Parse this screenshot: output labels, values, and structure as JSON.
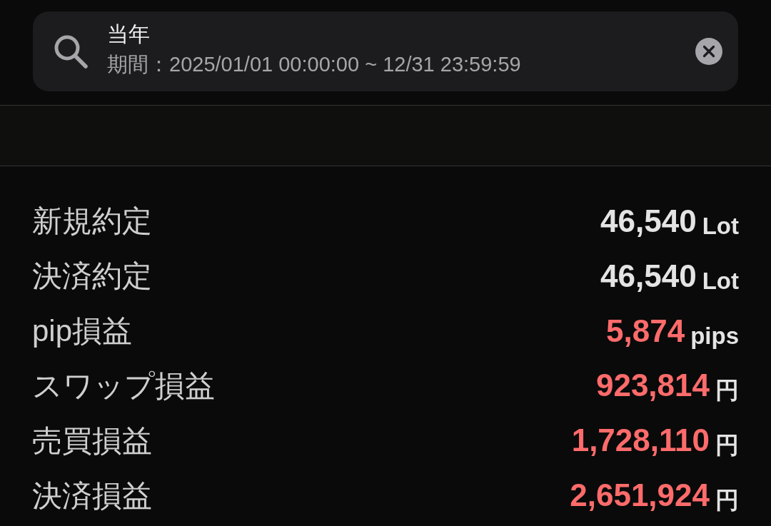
{
  "search": {
    "title": "当年",
    "period": "期間：2025/01/01 00:00:00 ~ 12/31 23:59:59"
  },
  "rows": [
    {
      "label": "新規約定",
      "value": "46,540",
      "unit": "Lot",
      "color": "#e4e4e4"
    },
    {
      "label": "決済約定",
      "value": "46,540",
      "unit": "Lot",
      "color": "#e4e4e4"
    },
    {
      "label": "pip損益",
      "value": "5,874",
      "unit": "pips",
      "color": "#ff6b6b"
    },
    {
      "label": "スワップ損益",
      "value": "923,814",
      "unit": "円",
      "color": "#ff6b6b"
    },
    {
      "label": "売買損益",
      "value": "1,728,110",
      "unit": "円",
      "color": "#ff6b6b"
    },
    {
      "label": "決済損益",
      "value": "2,651,924",
      "unit": "円",
      "color": "#ff6b6b"
    }
  ]
}
